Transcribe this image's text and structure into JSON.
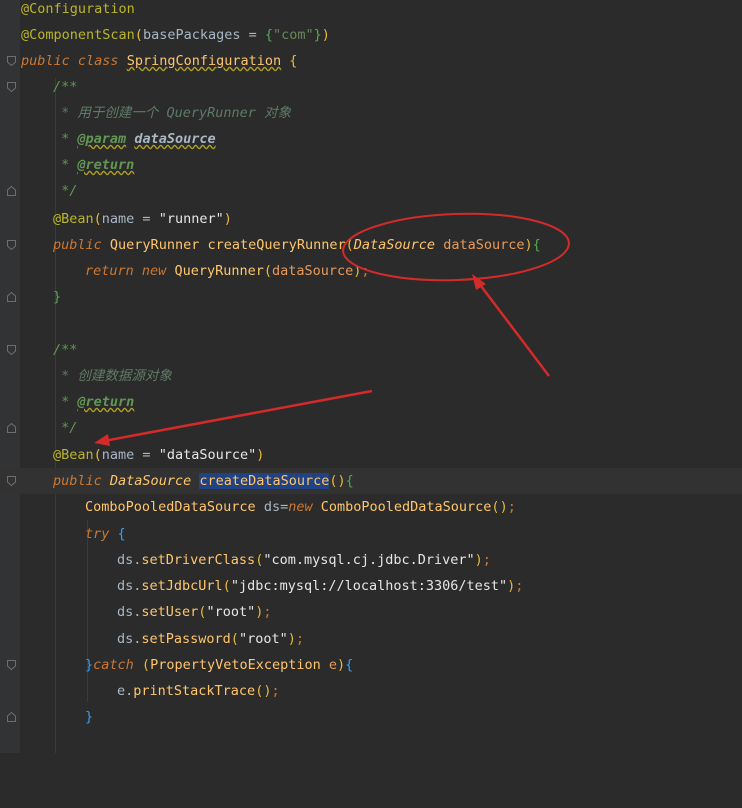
{
  "editor": {
    "lines": {
      "l1": {
        "ann": "@Configuration"
      },
      "l2": {
        "ann": "@ComponentScan",
        "p1": "(",
        "arg": "basePackages = ",
        "p2": "{",
        "str": "\"com\"",
        "p3": "}",
        "p4": ")"
      },
      "l3": {
        "kw1": "public",
        "kw2": "class",
        "cls": "SpringConfiguration",
        "brace": "{"
      },
      "l4": {
        "text": "/**"
      },
      "l5": {
        "text": " * 用于创建一个 QueryRunner 对象"
      },
      "l6": {
        "star": " * ",
        "tag": "@param",
        "param": "dataSource"
      },
      "l7": {
        "star": " * ",
        "tag": "@return"
      },
      "l8": {
        "text": " */"
      },
      "l9": {
        "ann": "@Bean",
        "p1": "(",
        "arg": "name = ",
        "str": "\"runner\"",
        "p2": ")"
      },
      "l10": {
        "kw": "public",
        "ret": "QueryRunner",
        "fn": "createQueryRunner",
        "p1": "(",
        "ptype": "DataSource",
        "pname": "dataSource",
        "p2": ")",
        "brace": "{"
      },
      "l11": {
        "kw1": "return",
        "kw2": "new",
        "cls": "QueryRunner",
        "p1": "(",
        "arg": "dataSource",
        "p2": ")",
        "semi": ";"
      },
      "l12": {
        "brace": "}"
      },
      "l14": {
        "text": "/**"
      },
      "l15": {
        "text": " * 创建数据源对象"
      },
      "l16": {
        "star": " * ",
        "tag": "@return"
      },
      "l17": {
        "text": " */"
      },
      "l18": {
        "ann": "@Bean",
        "p1": "(",
        "arg": "name = ",
        "str": "\"dataSource\"",
        "p2": ")"
      },
      "l19": {
        "kw": "public",
        "ret": "DataSource",
        "fn": "createDataSource",
        "p1": "(",
        "p2": ")",
        "brace": "{"
      },
      "l20": {
        "cls": "ComboPooledDataSource",
        "var": " ds=",
        "kw": "new",
        "cls2": "ComboPooledDataSource",
        "p1": "(",
        "p2": ")",
        "semi": ";"
      },
      "l21": {
        "kw": "try",
        "brace": "{"
      },
      "l22": {
        "obj": "ds.",
        "fn": "setDriverClass",
        "p1": "(",
        "str": "\"com.mysql.cj.jdbc.Driver\"",
        "p2": ")",
        "semi": ";"
      },
      "l23": {
        "obj": "ds.",
        "fn": "setJdbcUrl",
        "p1": "(",
        "str": "\"jdbc:mysql://localhost:3306/test\"",
        "p2": ")",
        "semi": ";"
      },
      "l24": {
        "obj": "ds.",
        "fn": "setUser",
        "p1": "(",
        "str": "\"root\"",
        "p2": ")",
        "semi": ";"
      },
      "l25": {
        "obj": "ds.",
        "fn": "setPassword",
        "p1": "(",
        "str": "\"root\"",
        "p2": ")",
        "semi": ";"
      },
      "l26": {
        "brace1": "}",
        "kw": "catch",
        "p1": "(",
        "cls": "PropertyVetoException",
        "var": "e",
        "p2": ")",
        "brace2": "{"
      },
      "l27": {
        "obj": "e.",
        "fn": "printStackTrace",
        "p1": "(",
        "p2": ")",
        "semi": ";"
      },
      "l28": {
        "brace": "}"
      }
    }
  },
  "annotations": {
    "circle_color": "#d42a2a",
    "arrow_color": "#d42a2a",
    "bulb_icon": "lightbulb-icon"
  }
}
